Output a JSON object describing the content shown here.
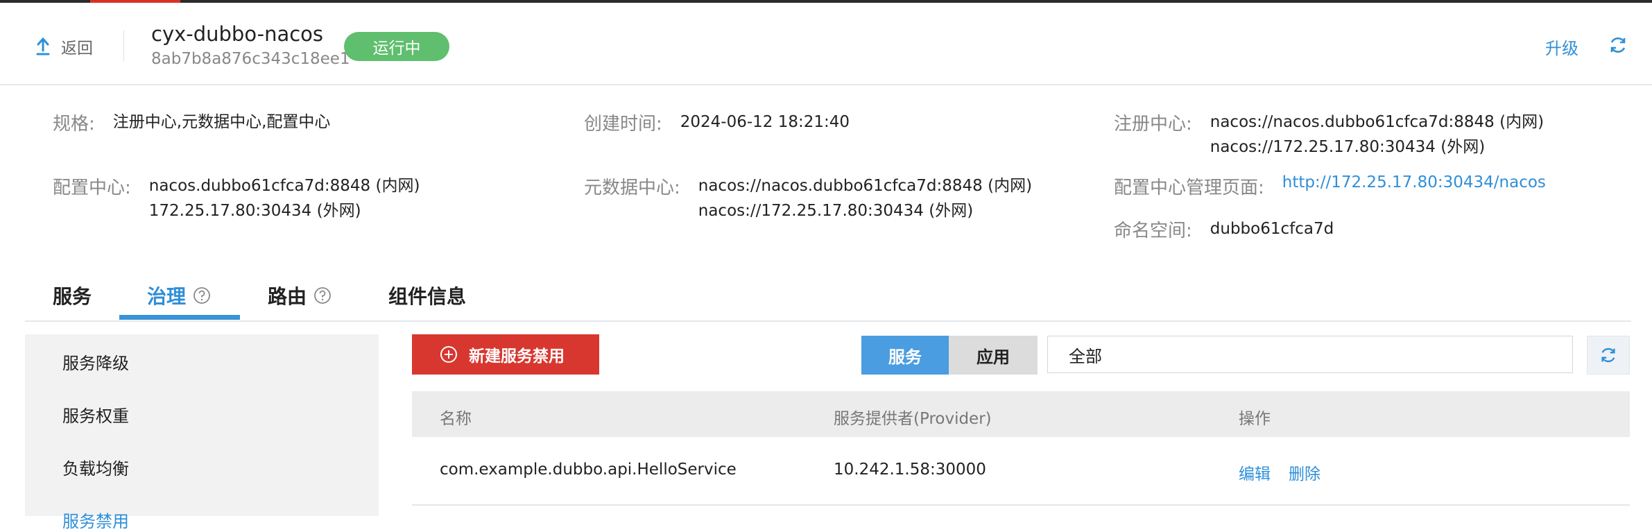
{
  "header": {
    "back_label": "返回",
    "instance_name": "cyx-dubbo-nacos",
    "instance_id": "8ab7b8a876c343c18ee1",
    "status": "运行中",
    "upgrade_label": "升级"
  },
  "info": {
    "spec_label": "规格:",
    "spec_value": "注册中心,元数据中心,配置中心",
    "created_label": "创建时间:",
    "created_value": "2024-06-12 18:21:40",
    "registry_label": "注册中心:",
    "registry_values": [
      "nacos://nacos.dubbo61cfca7d:8848 (内网)",
      "nacos://172.25.17.80:30434 (外网)"
    ],
    "config_label": "配置中心:",
    "config_values": [
      "nacos.dubbo61cfca7d:8848 (内网)",
      "172.25.17.80:30434 (外网)"
    ],
    "metadata_label": "元数据中心:",
    "metadata_values": [
      "nacos://nacos.dubbo61cfca7d:8848 (内网)",
      "nacos://172.25.17.80:30434 (外网)"
    ],
    "config_console_label": "配置中心管理页面:",
    "config_console_url": "http://172.25.17.80:30434/nacos",
    "namespace_label": "命名空间:",
    "namespace_value": "dubbo61cfca7d"
  },
  "tabs": [
    {
      "label": "服务"
    },
    {
      "label": "治理",
      "active": true
    },
    {
      "label": "路由"
    },
    {
      "label": "组件信息"
    }
  ],
  "side_menu": [
    {
      "label": "服务降级"
    },
    {
      "label": "服务权重"
    },
    {
      "label": "负载均衡"
    },
    {
      "label": "服务禁用"
    }
  ],
  "toolbar": {
    "add_label": "新建服务禁用",
    "segment_service": "服务",
    "segment_app": "应用",
    "filter_value": "全部"
  },
  "table": {
    "columns": [
      "名称",
      "服务提供者(Provider)",
      "操作"
    ],
    "rows": [
      {
        "name": "com.example.dubbo.api.HelloService",
        "provider": "10.242.1.58:30000",
        "edit": "编辑",
        "delete": "删除"
      }
    ]
  },
  "colors": {
    "accent": "#2f8fd8",
    "status_green": "#5fbf6e",
    "danger_red": "#d8372f"
  }
}
